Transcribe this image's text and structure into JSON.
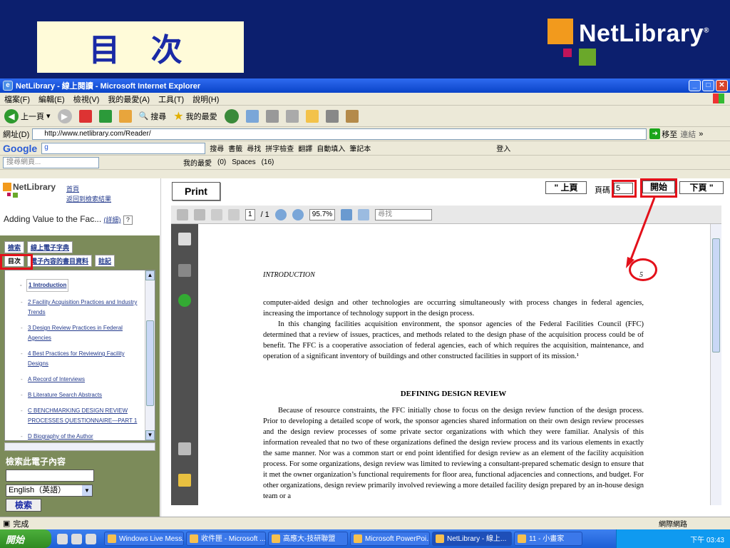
{
  "slide": {
    "title": "目 次",
    "logo_text": "NetLibrary",
    "logo_mark": "®"
  },
  "window": {
    "title": "NetLibrary - 線上閱讀 - Microsoft Internet Explorer"
  },
  "menu": [
    "檔案(F)",
    "編輯(E)",
    "檢視(V)",
    "我的最愛(A)",
    "工具(T)",
    "說明(H)"
  ],
  "toolbar": {
    "back": "上一頁",
    "search": "搜尋",
    "favorites": "我的最愛"
  },
  "address": {
    "label": "網址(D)",
    "url": "http://www.netlibrary.com/Reader/",
    "go": "移至",
    "links": "連結"
  },
  "googlebar": {
    "logo": "Google",
    "input": "g",
    "search": "搜尋",
    "bookmarks": "書籤",
    "find": "尋找",
    "spell": "拼字檢查",
    "translate": "翻譯",
    "autofill": "自動填入",
    "notebook": "筆記本",
    "signin": "登入"
  },
  "linksbar": {
    "placeholder": "搜尋網頁...",
    "favorites": "我的最愛",
    "count0": "(0)",
    "spaces": "Spaces",
    "count16": "(16)"
  },
  "left": {
    "logo": "NetLibrary",
    "home": "首頁",
    "back_results": "返回到檢索結果",
    "book_title": "Adding Value to the Fac...",
    "details": "(詳細)",
    "tabs_row1": [
      "檢索",
      "線上電子字典"
    ],
    "tabs_row2": [
      "目次",
      "電子內容的書目資料",
      "註記"
    ],
    "toc": [
      "1 Introduction",
      "2 Facility Acquisition Practices and Industry Trends",
      "3 Design Review Practices in Federal Agencies",
      "4 Best Practices for Reviewing Facility Designs",
      "A Record of Interviews",
      "B Literature Search Abstracts",
      "C BENCHMARKING DESIGN REVIEW PROCESSES QUESTIONNAIRE—PART 1",
      "D Biography of the Author"
    ],
    "search_title": "檢索此電子內容",
    "lang": "English（英語）",
    "search_btn": "檢索"
  },
  "reader": {
    "print": "Print",
    "prev": "\" 上頁",
    "page_label": "頁碼",
    "page_value": "5",
    "go": "開始",
    "next": "下頁 \"",
    "page_field": "1",
    "page_total": "/ 1",
    "zoom": "95.7%",
    "find": "尋找"
  },
  "page": {
    "running_head": "INTRODUCTION",
    "number": "5",
    "p1": "computer-aided design and other technologies are occurring simultaneously with process changes in federal agencies, increasing the importance of technology support in the design process.",
    "p2": "In this changing facilities acquisition environment, the sponsor agencies of the Federal Facilities Council (FFC) determined that a review of issues, practices, and methods related to the design phase of the acquisition process could be of benefit. The FFC is a cooperative association of federal agencies, each of which requires the acquisition, maintenance, and operation of a significant inventory of buildings and other constructed facilities in support of its mission.¹",
    "heading": "DEFINING DESIGN REVIEW",
    "p3": "Because of resource constraints, the FFC initially chose to focus on the design review function of the design process. Prior to developing a detailed scope of work, the sponsor agencies shared information on their own design review processes and the design review processes of some private sector organizations with which they were familiar. Analysis of this information revealed that no two of these organizations defined the design review process and its various elements in exactly the same manner. Nor was a common start or end point identified for design review as an element of the facility acquisition process. For some organizations, design review was limited to reviewing a consultant-prepared schematic design to ensure that it met the owner organization’s functional requirements for floor area, functional adjacencies and connections, and budget. For other organizations, design review primarily involved reviewing a more detailed facility design prepared by an in-house design team or a"
  },
  "status": {
    "done": "完成",
    "zone": "網際網路"
  },
  "taskbar": {
    "start": "開始",
    "tasks": [
      "Windows Live Mess...",
      "收件匣 - Microsoft ...",
      "高應大-技研聯盟",
      "Microsoft PowerPoi...",
      "NetLibrary - 線上...",
      "11 - 小畫家"
    ],
    "clock": "下午 03:43"
  }
}
